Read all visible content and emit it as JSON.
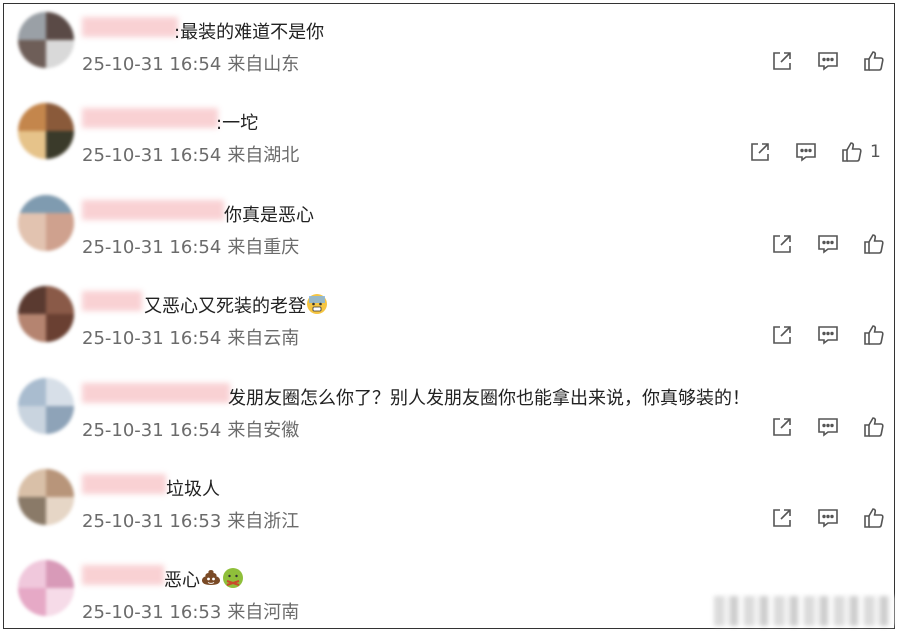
{
  "comments": [
    {
      "text": ":最装的难道不是你",
      "time": "25-10-31 16:54",
      "location": "来自山东",
      "like_count": ""
    },
    {
      "text": ":一坨",
      "time": "25-10-31 16:54",
      "location": "来自湖北",
      "like_count": "1"
    },
    {
      "text": "你真是恶心",
      "time": "25-10-31 16:54",
      "location": "来自重庆",
      "like_count": ""
    },
    {
      "text": "又恶心又死装的老登",
      "time": "25-10-31 16:54",
      "location": "来自云南",
      "like_count": ""
    },
    {
      "text": "发朋友圈怎么你了？别人发朋友圈你也能拿出来说，你真够装的！",
      "time": "25-10-31 16:54",
      "location": "来自安徽",
      "like_count": ""
    },
    {
      "text": "垃圾人",
      "time": "25-10-31 16:53",
      "location": "来自浙江",
      "like_count": ""
    },
    {
      "text": "恶心",
      "time": "25-10-31 16:53",
      "location": "来自河南",
      "like_count": ""
    }
  ],
  "icons": {
    "forward": "share-icon",
    "reply": "comment-icon",
    "like": "thumbs-up-icon",
    "emoji_cold_sweat": "anxious-face-emoji",
    "emoji_poop": "poop-emoji",
    "emoji_nauseated": "nauseated-face-emoji"
  },
  "colors": {
    "text": "#222222",
    "meta": "#6b6b6b",
    "icon": "#555555",
    "blur_name": "#f8c9cc"
  }
}
